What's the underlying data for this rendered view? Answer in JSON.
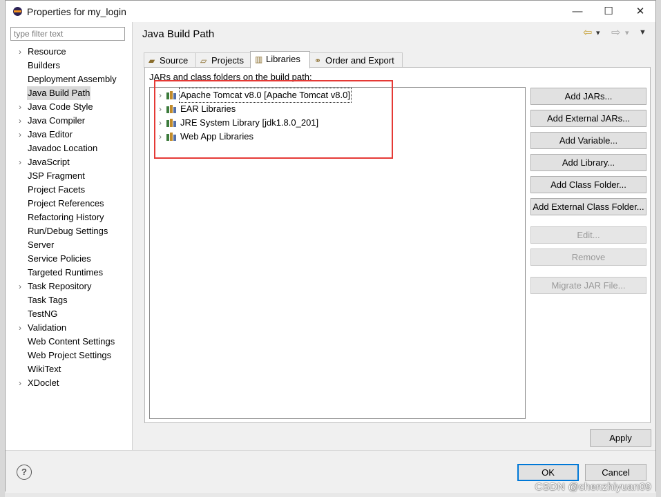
{
  "window": {
    "title": "Properties for my_login",
    "controls": {
      "minimize": "—",
      "maximize": "☐",
      "close": "✕"
    }
  },
  "sidebar": {
    "filter_placeholder": "type filter text",
    "items": [
      {
        "label": "Resource",
        "expandable": true
      },
      {
        "label": "Builders",
        "expandable": false
      },
      {
        "label": "Deployment Assembly",
        "expandable": false
      },
      {
        "label": "Java Build Path",
        "expandable": false,
        "selected": true
      },
      {
        "label": "Java Code Style",
        "expandable": true
      },
      {
        "label": "Java Compiler",
        "expandable": true
      },
      {
        "label": "Java Editor",
        "expandable": true
      },
      {
        "label": "Javadoc Location",
        "expandable": false
      },
      {
        "label": "JavaScript",
        "expandable": true
      },
      {
        "label": "JSP Fragment",
        "expandable": false
      },
      {
        "label": "Project Facets",
        "expandable": false
      },
      {
        "label": "Project References",
        "expandable": false
      },
      {
        "label": "Refactoring History",
        "expandable": false
      },
      {
        "label": "Run/Debug Settings",
        "expandable": false
      },
      {
        "label": "Server",
        "expandable": false
      },
      {
        "label": "Service Policies",
        "expandable": false
      },
      {
        "label": "Targeted Runtimes",
        "expandable": false
      },
      {
        "label": "Task Repository",
        "expandable": true
      },
      {
        "label": "Task Tags",
        "expandable": false
      },
      {
        "label": "TestNG",
        "expandable": false
      },
      {
        "label": "Validation",
        "expandable": true
      },
      {
        "label": "Web Content Settings",
        "expandable": false
      },
      {
        "label": "Web Project Settings",
        "expandable": false
      },
      {
        "label": "WikiText",
        "expandable": false
      },
      {
        "label": "XDoclet",
        "expandable": true
      }
    ]
  },
  "page": {
    "title": "Java Build Path",
    "nav": {
      "back": "⇦",
      "back_menu": "▾",
      "forward": "⇨",
      "forward_menu": "▾",
      "view_menu": "▼"
    }
  },
  "tabs": [
    {
      "label": "Source",
      "icon": "source-folder-icon"
    },
    {
      "label": "Projects",
      "icon": "projects-folder-icon"
    },
    {
      "label": "Libraries",
      "icon": "libraries-icon",
      "active": true
    },
    {
      "label": "Order and Export",
      "icon": "order-export-icon"
    }
  ],
  "libraries": {
    "heading": "JARs and class folders on the build path:",
    "entries": [
      {
        "label": "Apache Tomcat v8.0 [Apache Tomcat v8.0]",
        "focused": true
      },
      {
        "label": "EAR Libraries"
      },
      {
        "label": "JRE System Library [jdk1.8.0_201]"
      },
      {
        "label": "Web App Libraries"
      }
    ],
    "highlight_color": "#e53935"
  },
  "buttons": [
    {
      "label": "Add JARs...",
      "enabled": true
    },
    {
      "label": "Add External JARs...",
      "enabled": true
    },
    {
      "label": "Add Variable...",
      "enabled": true
    },
    {
      "label": "Add Library...",
      "enabled": true
    },
    {
      "label": "Add Class Folder...",
      "enabled": true
    },
    {
      "label": "Add External Class Folder...",
      "enabled": true
    },
    {
      "label": "Edit...",
      "enabled": false
    },
    {
      "label": "Remove",
      "enabled": false
    },
    {
      "label": "Migrate JAR File...",
      "enabled": false
    }
  ],
  "apply_label": "Apply",
  "footer": {
    "help": "?",
    "ok": "OK",
    "cancel": "Cancel"
  },
  "watermark": "CSDN @chenzhiyuan09",
  "colors": {
    "accent": "#0078d7",
    "selection": "#d9d9d9"
  }
}
